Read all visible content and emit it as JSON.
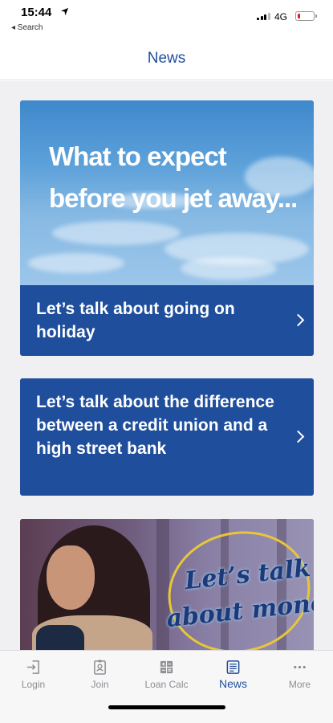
{
  "status_bar": {
    "time": "15:44",
    "back_label": "◂ Search",
    "network": "4G",
    "battery_level": 0.15,
    "battery_color": "#e02020"
  },
  "header": {
    "title": "News"
  },
  "news": [
    {
      "image_headline_line1": "What to expect",
      "image_headline_line2": "before you jet away...",
      "title": "Let’s talk about going on holiday"
    },
    {
      "title": "Let’s talk about the difference between a credit union and a high street bank"
    },
    {
      "image_text_line1": "Let’s talk",
      "image_text_line2": "about money"
    }
  ],
  "tab_bar": {
    "tabs": [
      {
        "label": "Login",
        "icon": "login-icon"
      },
      {
        "label": "Join",
        "icon": "id-badge-icon"
      },
      {
        "label": "Loan Calc",
        "icon": "calculator-icon"
      },
      {
        "label": "News",
        "icon": "newspaper-icon",
        "active": true
      },
      {
        "label": "More",
        "icon": "more-icon"
      }
    ]
  },
  "colors": {
    "brand_blue": "#1f4e9c",
    "tab_inactive": "#8e8e93",
    "background": "#f0f0f2"
  }
}
